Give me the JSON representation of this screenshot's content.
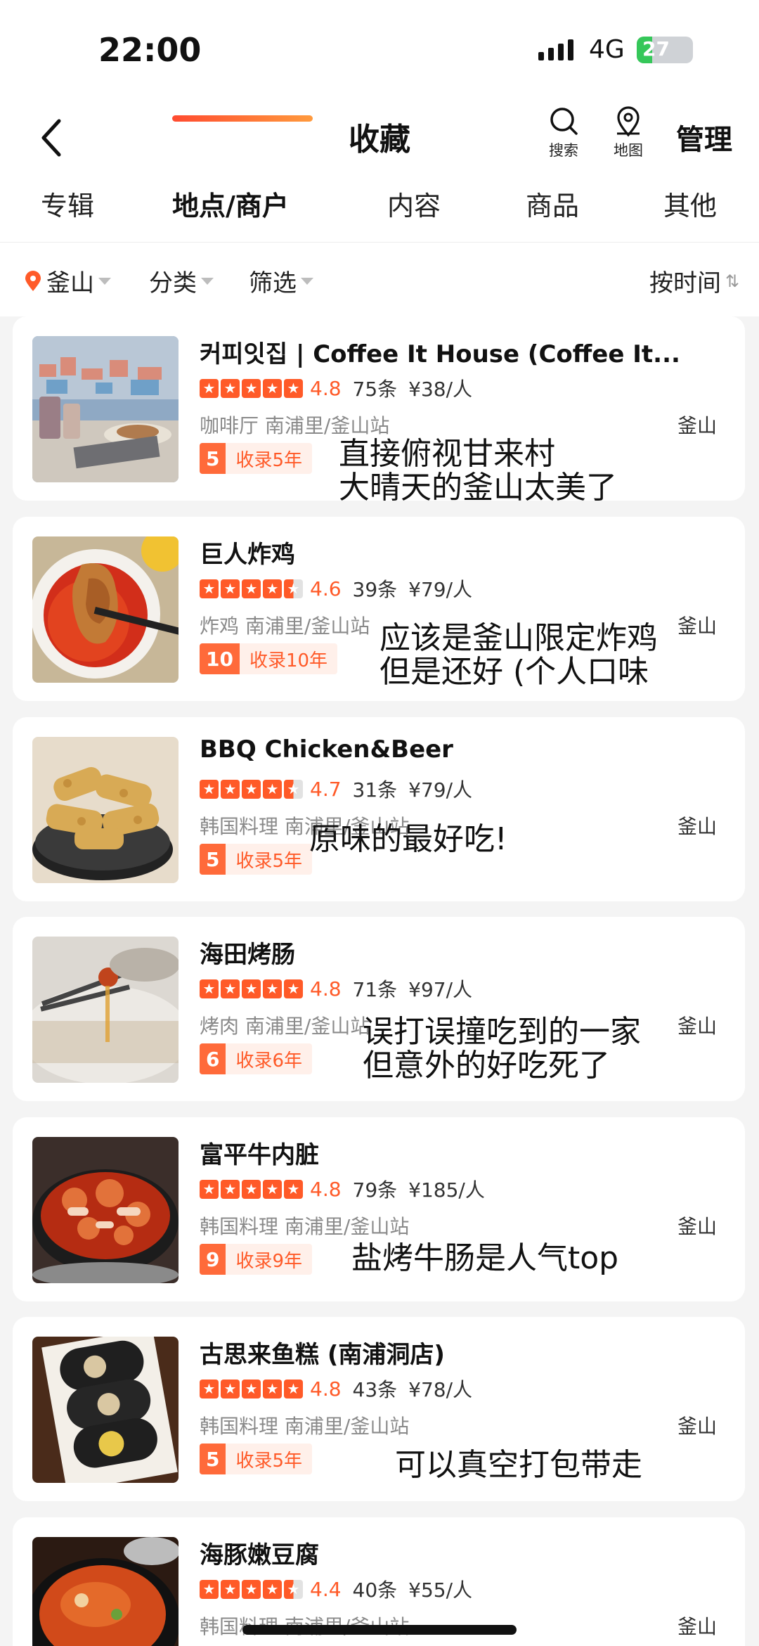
{
  "status_bar": {
    "time": "22:00",
    "network": "4G",
    "battery": "27",
    "battery_level": 0.27,
    "battery_color": "#35c759"
  },
  "header": {
    "title": "收藏",
    "search_label": "搜索",
    "map_label": "地图",
    "manage_label": "管理",
    "back_icon": "chevron-left-icon"
  },
  "tabs": [
    {
      "label": "专辑",
      "active": false
    },
    {
      "label": "地点/商户",
      "active": true
    },
    {
      "label": "内容",
      "active": false
    },
    {
      "label": "商品",
      "active": false
    },
    {
      "label": "其他",
      "active": false
    }
  ],
  "filters": {
    "city": "釜山",
    "category": "分类",
    "filter": "筛选",
    "sort": "按时间"
  },
  "accent_color": "#ff5a28",
  "cards": [
    {
      "name": "커피잇집 | Coffee It House (Coffee It...",
      "score": "4.8",
      "rating": 4.8,
      "reviews": "75条",
      "price": "¥38/人",
      "category": "咖啡厅",
      "area": "南浦里/釜山站",
      "city": "釜山",
      "badge_num": "5",
      "badge_text": "收录5年",
      "note": "直接俯视甘来村\n大晴天的釜山太美了",
      "image": "village-cafe-photo"
    },
    {
      "name": "巨人炸鸡",
      "score": "4.6",
      "rating": 4.6,
      "reviews": "39条",
      "price": "¥79/人",
      "category": "炸鸡",
      "area": "南浦里/釜山站",
      "city": "釜山",
      "badge_num": "10",
      "badge_text": "收录10年",
      "note": "应该是釜山限定炸鸡\n但是还好 (个人口味",
      "image": "fried-chicken-photo"
    },
    {
      "name": "BBQ Chicken&Beer",
      "score": "4.7",
      "rating": 4.7,
      "reviews": "31条",
      "price": "¥79/人",
      "category": "韩国料理",
      "area": "南浦里/釜山站",
      "city": "釜山",
      "badge_num": "5",
      "badge_text": "收录5年",
      "note": "原味的最好吃!",
      "image": "chicken-basket-photo"
    },
    {
      "name": "海田烤肠",
      "score": "4.8",
      "rating": 4.8,
      "reviews": "71条",
      "price": "¥97/人",
      "category": "烤肉",
      "area": "南浦里/釜山站",
      "city": "釜山",
      "badge_num": "6",
      "badge_text": "收录6年",
      "note": "误打误撞吃到的一家\n但意外的好吃死了",
      "image": "grilled-intestine-photo"
    },
    {
      "name": "富平牛内脏",
      "score": "4.8",
      "rating": 4.8,
      "reviews": "79条",
      "price": "¥185/人",
      "category": "韩国料理",
      "area": "南浦里/釜山站",
      "city": "釜山",
      "badge_num": "9",
      "badge_text": "收录9年",
      "note": "盐烤牛肠是人气top",
      "image": "beef-tripe-pan-photo"
    },
    {
      "name": "古思来鱼糕 (南浦洞店)",
      "score": "4.8",
      "rating": 4.8,
      "reviews": "43条",
      "price": "¥78/人",
      "category": "韩国料理",
      "area": "南浦里/釜山站",
      "city": "釜山",
      "badge_num": "5",
      "badge_text": "收录5年",
      "note": "可以真空打包带走",
      "image": "fishcake-roll-photo"
    },
    {
      "name": "海豚嫩豆腐",
      "score": "4.4",
      "rating": 4.4,
      "reviews": "40条",
      "price": "¥55/人",
      "category": "韩国料理",
      "area": "南浦里/釜山站",
      "city": "釜山",
      "badge_num": "",
      "badge_text": "",
      "note": "",
      "image": "soft-tofu-stew-photo"
    }
  ]
}
